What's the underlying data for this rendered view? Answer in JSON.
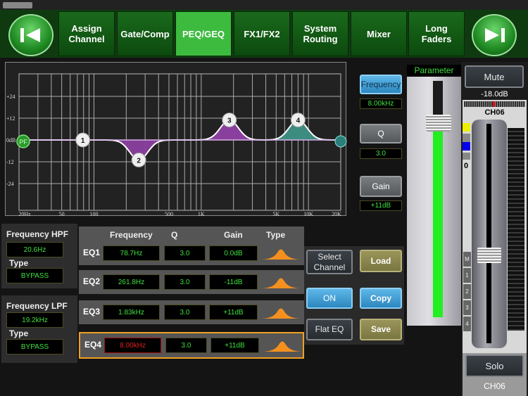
{
  "nav": {
    "tabs": [
      {
        "label": "Assign Channel"
      },
      {
        "label": "Gate/Comp"
      },
      {
        "label": "PEQ/GEQ",
        "active": true
      },
      {
        "label": "FX1/FX2"
      },
      {
        "label": "System Routing"
      },
      {
        "label": "Mixer"
      },
      {
        "label": "Long Faders"
      }
    ],
    "prev_icon": "skip-back-icon",
    "next_icon": "skip-forward-icon"
  },
  "graph": {
    "y_labels": [
      "+24",
      "+12",
      "0dB",
      "-12",
      "-24"
    ],
    "x_labels": [
      "20Hz",
      "50",
      "100",
      "500",
      "1K",
      "5K",
      "10K",
      "20K"
    ],
    "hpf_marker": "PF",
    "bands": [
      "1",
      "2",
      "3",
      "4"
    ],
    "fill_colors": [
      "#8a3f9e",
      "#3d8c80"
    ]
  },
  "param_buttons": {
    "frequency": {
      "label": "Frequency",
      "value": "8.00kHz"
    },
    "q": {
      "label": "Q",
      "value": "3.0"
    },
    "gain": {
      "label": "Gain",
      "value": "+11dB"
    }
  },
  "parameter": {
    "title": "Parameter",
    "level_percent": 82
  },
  "channel": {
    "mute": "Mute",
    "level": "-18.0dB",
    "name": "CH06",
    "scale_zero": "0",
    "groups": [
      "M",
      "1",
      "2",
      "3",
      "4"
    ],
    "solo": "Solo",
    "footer": "CH06",
    "fader_percent": 40
  },
  "hpf": {
    "title": "Frequency HPF",
    "value": "20.6Hz",
    "type_label": "Type",
    "type": "BYPASS"
  },
  "lpf": {
    "title": "Frequency LPF",
    "value": "19.2kHz",
    "type_label": "Type",
    "type": "BYPASS"
  },
  "eq_table": {
    "headers": [
      "Frequency",
      "Q",
      "Gain",
      "Type"
    ],
    "rows": [
      {
        "name": "EQ1",
        "frequency": "78.7Hz",
        "q": "3.0",
        "gain": "0.0dB",
        "f": 78.7,
        "g": 0
      },
      {
        "name": "EQ2",
        "frequency": "261.8Hz",
        "q": "3.0",
        "gain": "-11dB",
        "f": 261.8,
        "g": -11
      },
      {
        "name": "EQ3",
        "frequency": "1.83kHz",
        "q": "3.0",
        "gain": "+11dB",
        "f": 1830,
        "g": 11
      },
      {
        "name": "EQ4",
        "frequency": "8.00kHz",
        "q": "3.0",
        "gain": "+11dB",
        "f": 8000,
        "g": 11,
        "selected": true
      }
    ],
    "type_icon": "bell-curve-icon"
  },
  "actions": {
    "select_channel": "Select Channel",
    "on": "ON",
    "flat_eq": "Flat EQ",
    "load": "Load",
    "copy": "Copy",
    "save": "Save"
  }
}
